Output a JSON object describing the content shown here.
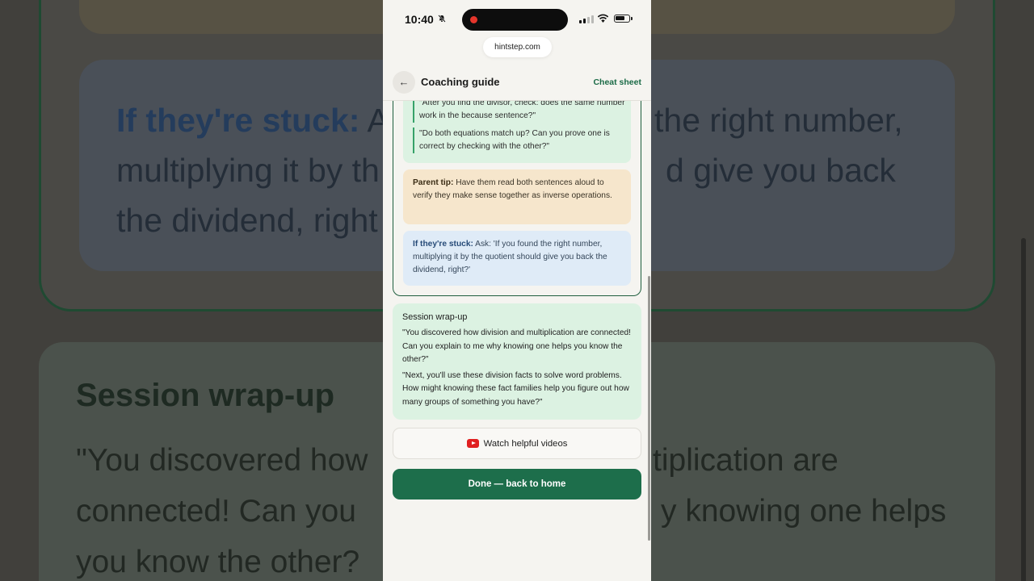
{
  "background": {
    "stuck_label": "If they're stuck:",
    "stuck_line1_rest": " A",
    "stuck_line1_right": "the right number,",
    "stuck_line2": "multiplying it by th",
    "stuck_line2_right": "d give you back",
    "stuck_line3": "the dividend, right",
    "wrap_title": "Session wrap-up",
    "wrap_line1": "\"You discovered how",
    "wrap_line1_right": "tiplication are",
    "wrap_line2": "connected! Can you",
    "wrap_line2_right": "y knowing one helps",
    "wrap_line3": "you know the other?"
  },
  "status_bar": {
    "time": "10:40"
  },
  "browser": {
    "url": "hintstep.com"
  },
  "header": {
    "back_glyph": "←",
    "title": "Coaching guide",
    "cheat_sheet": "Cheat sheet"
  },
  "step": {
    "quotes": [
      "\"After you find the divisor, check: does the same number work in the because sentence?\"",
      "\"Do both equations match up? Can you prove one is correct by checking with the other?\""
    ],
    "parent_tip_label": "Parent tip:",
    "parent_tip_text": " Have them read both sentences aloud to verify they make sense together as inverse operations.",
    "stuck_label": "If they're stuck:",
    "stuck_text": " Ask: 'If you found the right number, multiplying it by the quotient should give you back the dividend, right?'"
  },
  "wrap_up": {
    "title": "Session wrap-up",
    "paragraphs": [
      "\"You discovered how division and multiplication are connected! Can you explain to me why knowing one helps you know the other?\"",
      "\"Next, you'll use these division facts to solve word problems. How might knowing these fact families help you figure out how many groups of something you have?\""
    ]
  },
  "buttons": {
    "videos": "Watch helpful videos",
    "done": "Done — back to home"
  },
  "icons": [
    "bell-slash-icon",
    "signal-icon",
    "wifi-icon",
    "battery-icon",
    "back-arrow-icon",
    "youtube-icon"
  ],
  "colors": {
    "accent": "#1d6e4b",
    "green_bg": "#dcf2e2",
    "tip_bg": "#f6e6cc",
    "stuck_bg": "#dfebf7",
    "record_dot": "#e5352b"
  }
}
